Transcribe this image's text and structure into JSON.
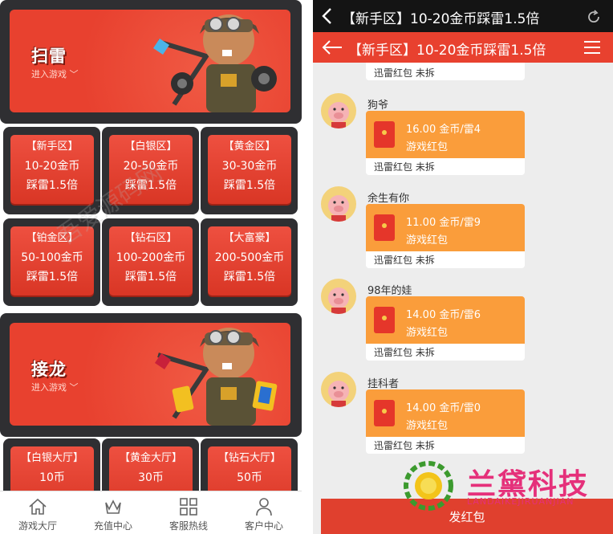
{
  "left": {
    "banners": [
      {
        "title": "扫雷",
        "subtitle": "进入游戏 ﹀"
      },
      {
        "title": "接龙",
        "subtitle": "进入游戏 ﹀"
      }
    ],
    "tiles": [
      {
        "zone": "【新手区】",
        "range": "10-20金币",
        "rate": "踩雷1.5倍"
      },
      {
        "zone": "【白银区】",
        "range": "20-50金币",
        "rate": "踩雷1.5倍"
      },
      {
        "zone": "【黄金区】",
        "range": "30-30金币",
        "rate": "踩雷1.5倍"
      },
      {
        "zone": "【铂金区】",
        "range": "50-100金币",
        "rate": "踩雷1.5倍"
      },
      {
        "zone": "【钻石区】",
        "range": "100-200金币",
        "rate": "踩雷1.5倍"
      },
      {
        "zone": "【大富豪】",
        "range": "200-500金币",
        "rate": "踩雷1.5倍"
      }
    ],
    "halls": [
      {
        "name": "【白银大厅】",
        "coins": "10币"
      },
      {
        "name": "【黄金大厅】",
        "coins": "30币"
      },
      {
        "name": "【钻石大厅】",
        "coins": "50币"
      }
    ],
    "tabbar": [
      {
        "label": "游戏大厅",
        "icon": "home-icon"
      },
      {
        "label": "充值中心",
        "icon": "crown-icon"
      },
      {
        "label": "客服热线",
        "icon": "grid-icon"
      },
      {
        "label": "客户中心",
        "icon": "user-icon"
      }
    ]
  },
  "right": {
    "window_title": "【新手区】10-20金币踩雷1.5倍",
    "app_title": "【新手区】10-20金币踩雷1.5倍",
    "top_partial_footer": "迅雷红包 未拆",
    "messages": [
      {
        "nick": "狗爷",
        "amount": "16.00 金币/雷4",
        "kind": "游戏红包",
        "footer": "迅雷红包 未拆"
      },
      {
        "nick": "余生有你",
        "amount": "11.00 金币/雷9",
        "kind": "游戏红包",
        "footer": "迅雷红包 未拆"
      },
      {
        "nick": "98年的娃",
        "amount": "14.00 金币/雷6",
        "kind": "游戏红包",
        "footer": "迅雷红包 未拆"
      },
      {
        "nick": "挂科者",
        "amount": "14.00 金币/雷0",
        "kind": "游戏红包",
        "footer": "迅雷红包 未拆"
      }
    ],
    "send_button": "发红包"
  },
  "brand": {
    "name": "兰黛科技",
    "pinyin": "LANDAIKEJIRUANJIAN"
  },
  "watermark": {
    "text": "吾爱源码网"
  },
  "colors": {
    "accent": "#e8412f",
    "packet": "#fa9d3b",
    "dark": "#2f2f32",
    "brand": "#e5307a"
  }
}
